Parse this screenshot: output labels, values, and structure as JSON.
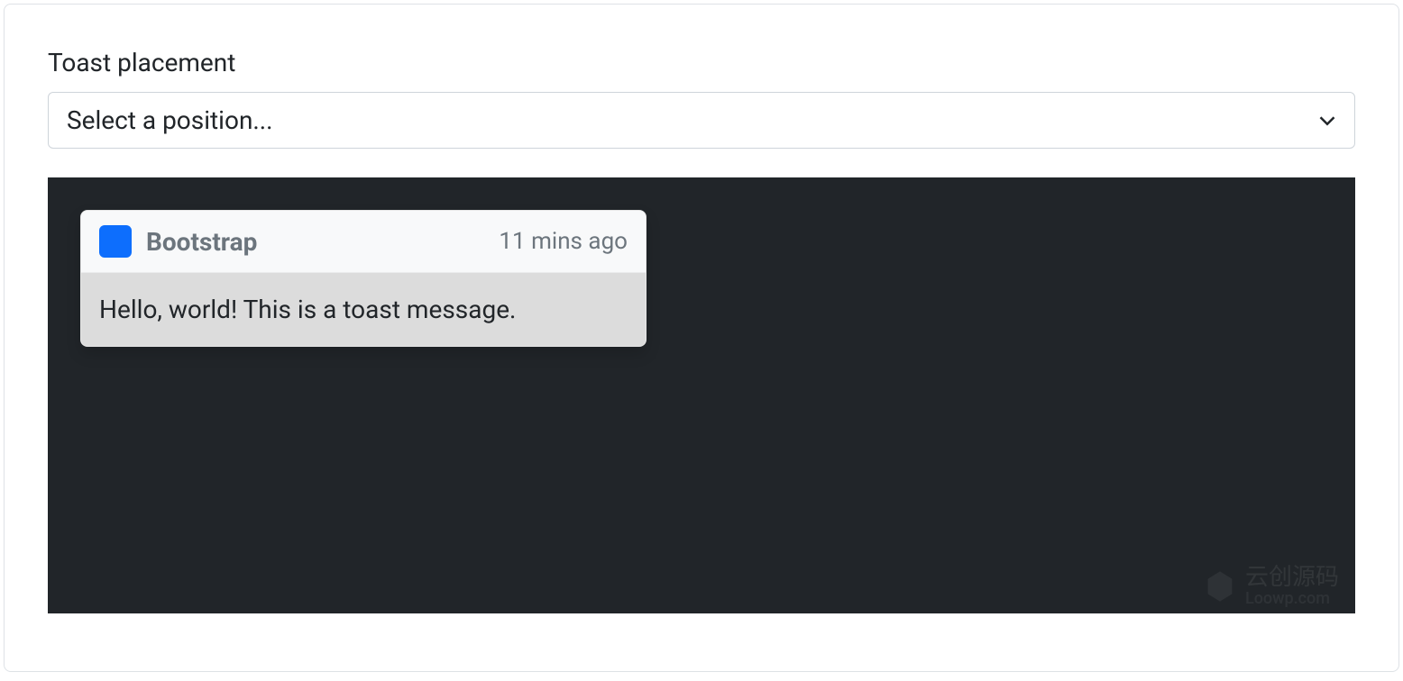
{
  "form": {
    "label": "Toast placement",
    "select": {
      "placeholder": "Select a position..."
    }
  },
  "toast": {
    "title": "Bootstrap",
    "time": "11 mins ago",
    "body": "Hello, world! This is a toast message."
  },
  "watermark": {
    "main": "云创源码",
    "sub": "Loowp.com"
  },
  "colors": {
    "dark_bg": "#212529",
    "primary": "#0d6efd",
    "muted": "#6c757d",
    "border": "#dee2e6"
  }
}
